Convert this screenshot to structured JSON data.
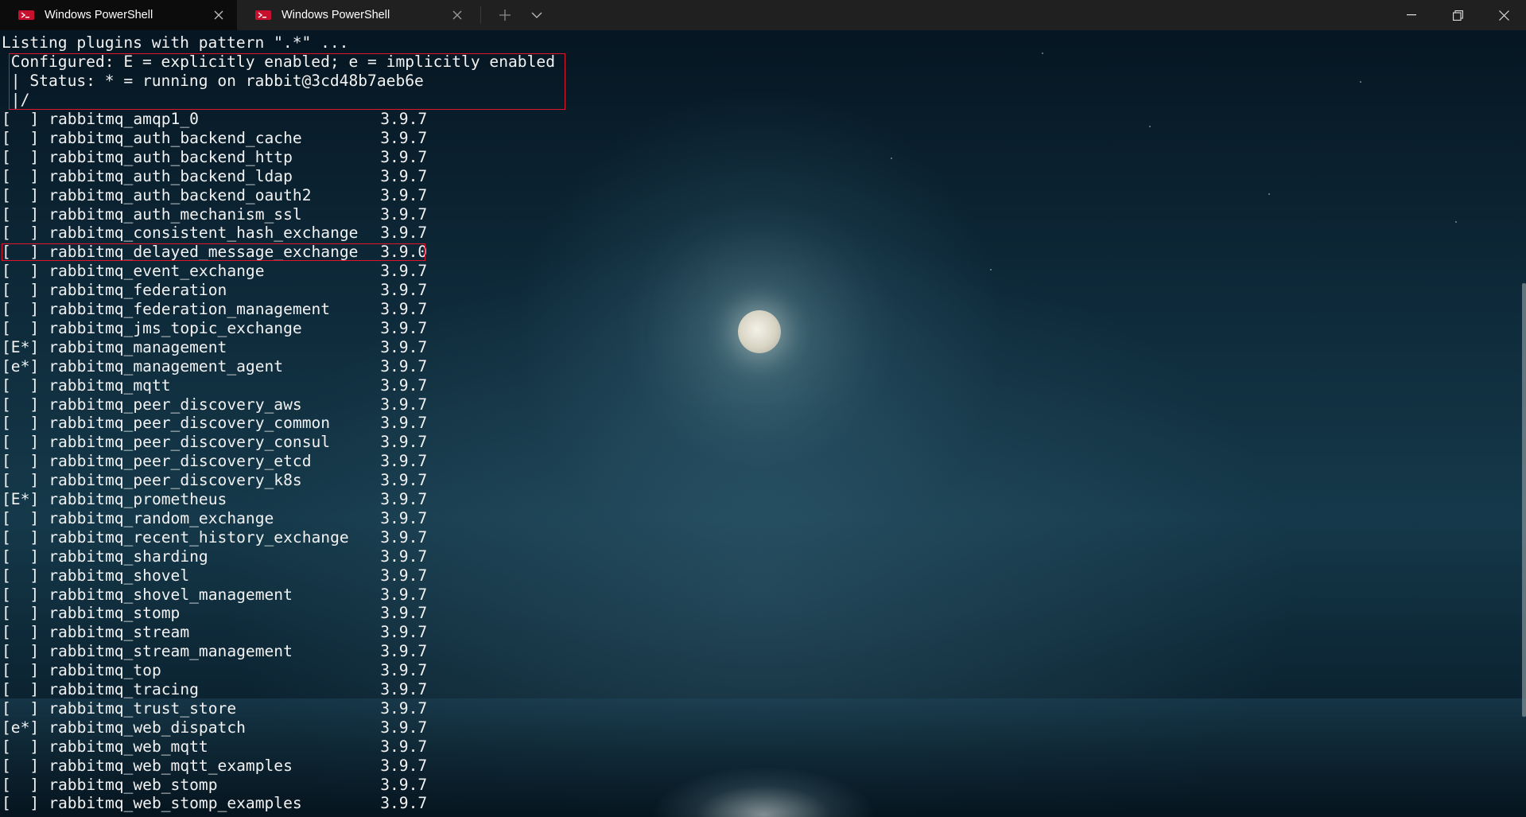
{
  "window": {
    "tabs": [
      {
        "title": "Windows PowerShell",
        "active": true
      },
      {
        "title": "Windows PowerShell",
        "active": false
      }
    ],
    "icons": {
      "tab_icon": "powershell-icon",
      "close": "close-icon",
      "new_tab": "plus-icon",
      "dropdown": "chevron-down-icon",
      "minimize": "minimize-icon",
      "maximize": "restore-icon",
      "window_close": "close-icon"
    }
  },
  "terminal": {
    "header": "Listing plugins with pattern \".*\" ...",
    "legend": [
      " Configured: E = explicitly enabled; e = implicitly enabled",
      " | Status: * = running on rabbit@3cd48b7aeb6e",
      " |/"
    ],
    "plugins": [
      {
        "flags": "[  ]",
        "name": "rabbitmq_amqp1_0",
        "version": "3.9.7"
      },
      {
        "flags": "[  ]",
        "name": "rabbitmq_auth_backend_cache",
        "version": "3.9.7"
      },
      {
        "flags": "[  ]",
        "name": "rabbitmq_auth_backend_http",
        "version": "3.9.7"
      },
      {
        "flags": "[  ]",
        "name": "rabbitmq_auth_backend_ldap",
        "version": "3.9.7"
      },
      {
        "flags": "[  ]",
        "name": "rabbitmq_auth_backend_oauth2",
        "version": "3.9.7"
      },
      {
        "flags": "[  ]",
        "name": "rabbitmq_auth_mechanism_ssl",
        "version": "3.9.7"
      },
      {
        "flags": "[  ]",
        "name": "rabbitmq_consistent_hash_exchange",
        "version": "3.9.7"
      },
      {
        "flags": "[  ]",
        "name": "rabbitmq_delayed_message_exchange",
        "version": "3.9.0",
        "highlighted": true
      },
      {
        "flags": "[  ]",
        "name": "rabbitmq_event_exchange",
        "version": "3.9.7"
      },
      {
        "flags": "[  ]",
        "name": "rabbitmq_federation",
        "version": "3.9.7"
      },
      {
        "flags": "[  ]",
        "name": "rabbitmq_federation_management",
        "version": "3.9.7"
      },
      {
        "flags": "[  ]",
        "name": "rabbitmq_jms_topic_exchange",
        "version": "3.9.7"
      },
      {
        "flags": "[E*]",
        "name": "rabbitmq_management",
        "version": "3.9.7"
      },
      {
        "flags": "[e*]",
        "name": "rabbitmq_management_agent",
        "version": "3.9.7"
      },
      {
        "flags": "[  ]",
        "name": "rabbitmq_mqtt",
        "version": "3.9.7"
      },
      {
        "flags": "[  ]",
        "name": "rabbitmq_peer_discovery_aws",
        "version": "3.9.7"
      },
      {
        "flags": "[  ]",
        "name": "rabbitmq_peer_discovery_common",
        "version": "3.9.7"
      },
      {
        "flags": "[  ]",
        "name": "rabbitmq_peer_discovery_consul",
        "version": "3.9.7"
      },
      {
        "flags": "[  ]",
        "name": "rabbitmq_peer_discovery_etcd",
        "version": "3.9.7"
      },
      {
        "flags": "[  ]",
        "name": "rabbitmq_peer_discovery_k8s",
        "version": "3.9.7"
      },
      {
        "flags": "[E*]",
        "name": "rabbitmq_prometheus",
        "version": "3.9.7"
      },
      {
        "flags": "[  ]",
        "name": "rabbitmq_random_exchange",
        "version": "3.9.7"
      },
      {
        "flags": "[  ]",
        "name": "rabbitmq_recent_history_exchange",
        "version": "3.9.7"
      },
      {
        "flags": "[  ]",
        "name": "rabbitmq_sharding",
        "version": "3.9.7"
      },
      {
        "flags": "[  ]",
        "name": "rabbitmq_shovel",
        "version": "3.9.7"
      },
      {
        "flags": "[  ]",
        "name": "rabbitmq_shovel_management",
        "version": "3.9.7"
      },
      {
        "flags": "[  ]",
        "name": "rabbitmq_stomp",
        "version": "3.9.7"
      },
      {
        "flags": "[  ]",
        "name": "rabbitmq_stream",
        "version": "3.9.7"
      },
      {
        "flags": "[  ]",
        "name": "rabbitmq_stream_management",
        "version": "3.9.7"
      },
      {
        "flags": "[  ]",
        "name": "rabbitmq_top",
        "version": "3.9.7"
      },
      {
        "flags": "[  ]",
        "name": "rabbitmq_tracing",
        "version": "3.9.7"
      },
      {
        "flags": "[  ]",
        "name": "rabbitmq_trust_store",
        "version": "3.9.7"
      },
      {
        "flags": "[e*]",
        "name": "rabbitmq_web_dispatch",
        "version": "3.9.7"
      },
      {
        "flags": "[  ]",
        "name": "rabbitmq_web_mqtt",
        "version": "3.9.7"
      },
      {
        "flags": "[  ]",
        "name": "rabbitmq_web_mqtt_examples",
        "version": "3.9.7"
      },
      {
        "flags": "[  ]",
        "name": "rabbitmq_web_stomp",
        "version": "3.9.7"
      },
      {
        "flags": "[  ]",
        "name": "rabbitmq_web_stomp_examples",
        "version": "3.9.7"
      }
    ],
    "colors": {
      "text": "#f2f2f2",
      "highlight_box": "#e0142a",
      "titlebar": "#202020",
      "active_tab": "#0c0c0c"
    }
  }
}
